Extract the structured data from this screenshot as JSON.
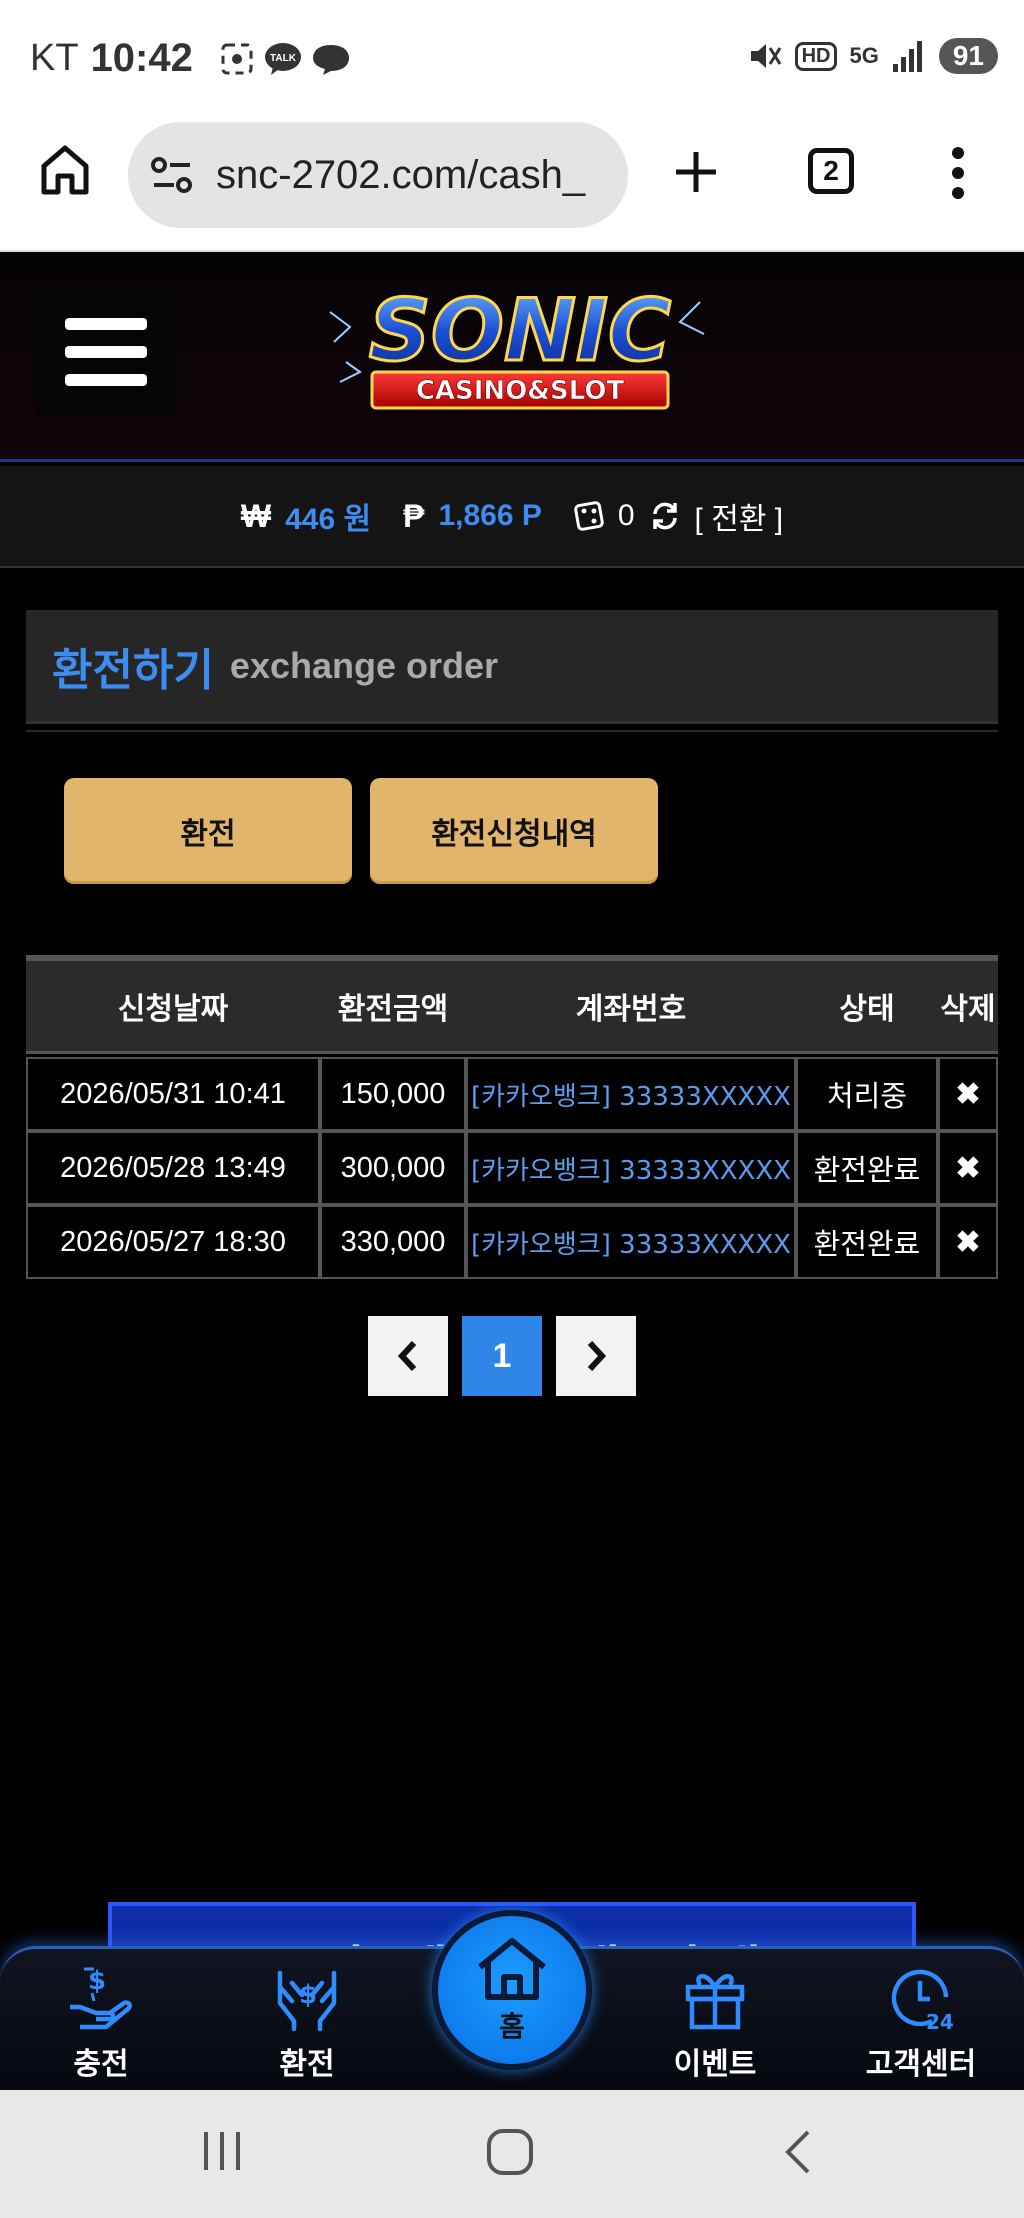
{
  "status_bar": {
    "carrier": "KT",
    "time": "10:42",
    "battery": "91",
    "hd_label": "HD",
    "network_label": "5G"
  },
  "browser": {
    "url": "snc-2702.com/cash_",
    "tab_count": "2"
  },
  "header": {
    "logo_main": "SONIC",
    "logo_sub": "CASINO&SLOT"
  },
  "balance": {
    "won_symbol": "₩",
    "won_value": "446 원",
    "point_symbol": "₱",
    "point_value": "1,866 P",
    "casino_value": "0",
    "convert_label": "[ 전환 ]"
  },
  "page": {
    "title": "환전하기",
    "subtitle": "exchange order"
  },
  "tabs": {
    "exchange": "환전",
    "history": "환전신청내역"
  },
  "table": {
    "headers": [
      "신청날짜",
      "환전금액",
      "계좌번호",
      "상태",
      "삭제"
    ],
    "rows": [
      {
        "date": "2026/05/31 10:41",
        "amount": "150,000",
        "account": "[카카오뱅크] 33333XXXXX",
        "status": "처리중",
        "delete": "✖"
      },
      {
        "date": "2026/05/28 13:49",
        "amount": "300,000",
        "account": "[카카오뱅크] 33333XXXXX",
        "status": "환전완료",
        "delete": "✖"
      },
      {
        "date": "2026/05/27 18:30",
        "amount": "330,000",
        "account": "[카카오뱅크] 33333XXXXX",
        "status": "환전완료",
        "delete": "✖"
      }
    ]
  },
  "pagination": {
    "current": "1"
  },
  "banner": {
    "text": "공지 텔레그램 안내"
  },
  "bottom_nav": {
    "charge": "충전",
    "exchange": "환전",
    "home": "홈",
    "event": "이벤트",
    "support": "고객센터"
  },
  "colors": {
    "accent_blue": "#3d8df0",
    "button_gold": "#e2b56c",
    "page_bg": "#000000"
  }
}
